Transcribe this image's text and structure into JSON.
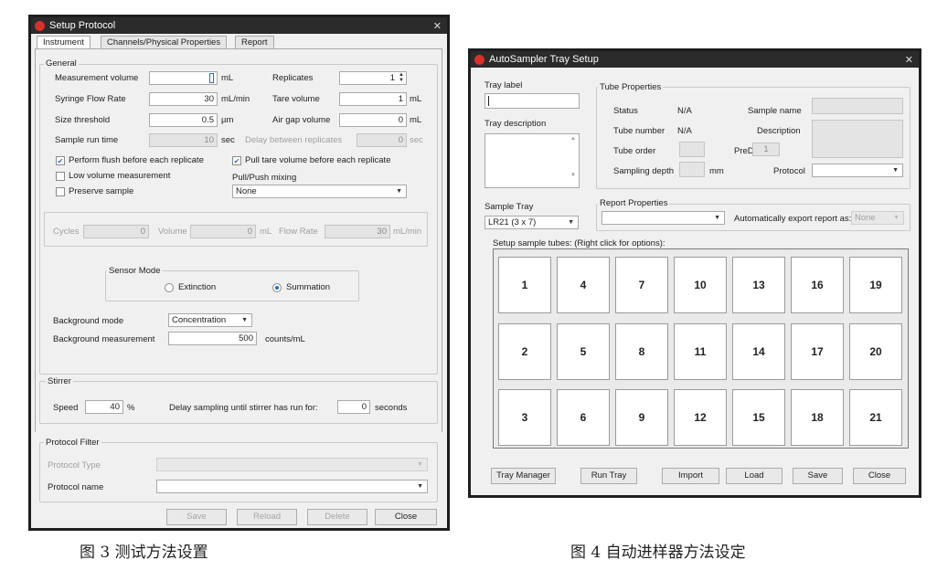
{
  "setup_protocol": {
    "title": "Setup Protocol",
    "tabs": [
      "Instrument",
      "Channels/Physical Properties",
      "Report"
    ],
    "general": {
      "label": "General",
      "measurement_volume": {
        "label": "Measurement volume",
        "value": "",
        "unit": "mL"
      },
      "replicates": {
        "label": "Replicates",
        "value": "1"
      },
      "syringe_flow_rate": {
        "label": "Syringe Flow Rate",
        "value": "30",
        "unit": "mL/min"
      },
      "tare_volume": {
        "label": "Tare volume",
        "value": "1",
        "unit": "mL"
      },
      "size_threshold": {
        "label": "Size threshold",
        "value": "0.5",
        "unit": "µm"
      },
      "air_gap_volume": {
        "label": "Air gap volume",
        "value": "0",
        "unit": "mL"
      },
      "sample_run_time": {
        "label": "Sample run time",
        "value": "10",
        "unit": "sec"
      },
      "delay_between_replicates": {
        "label": "Delay between replicates",
        "value": "0",
        "unit": "sec"
      },
      "perform_flush": {
        "label": "Perform flush before each replicate",
        "checked": true
      },
      "pull_tare": {
        "label": "Pull tare volume before each replicate",
        "checked": true
      },
      "low_volume": {
        "label": "Low volume measurement",
        "checked": false
      },
      "pull_push_mixing": {
        "label": "Pull/Push mixing",
        "value": "None"
      },
      "preserve_sample": {
        "label": "Preserve sample",
        "checked": false
      }
    },
    "cycles_row": {
      "cycles_label": "Cycles",
      "cycles_value": "0",
      "volume_label": "Volume",
      "volume_value": "0",
      "volume_unit": "mL",
      "flow_rate_label": "Flow Rate",
      "flow_rate_value": "30",
      "flow_rate_unit": "mL/min"
    },
    "sensor_mode": {
      "label": "Sensor Mode",
      "extinction": "Extinction",
      "summation": "Summation",
      "selected": "Summation"
    },
    "background_mode": {
      "label": "Background mode",
      "value": "Concentration"
    },
    "background_measurement": {
      "label": "Background measurement",
      "value": "500",
      "unit": "counts/mL"
    },
    "stirrer": {
      "label": "Stirrer",
      "speed_label": "Speed",
      "speed_value": "40",
      "speed_unit": "%",
      "delay_label": "Delay sampling until stirrer has run for:",
      "delay_value": "0",
      "delay_unit": "seconds"
    },
    "protocol_filter": {
      "label": "Protocol Filter",
      "type_label": "Protocol Type",
      "type_value": "",
      "name_label": "Protocol name",
      "name_value": ""
    },
    "buttons": {
      "save": "Save",
      "reload": "Reload",
      "delete": "Delete",
      "close": "Close"
    }
  },
  "autosampler": {
    "title": "AutoSampler Tray Setup",
    "tray_label": {
      "label": "Tray label",
      "value": ""
    },
    "tray_description": {
      "label": "Tray description",
      "value": ""
    },
    "tube_properties": {
      "label": "Tube Properties",
      "status_label": "Status",
      "status_value": "N/A",
      "sample_name_label": "Sample name",
      "tube_number_label": "Tube number",
      "tube_number_value": "N/A",
      "description_label": "Description",
      "tube_order_label": "Tube order",
      "predf_label": "PreDF",
      "predf_value": "1",
      "sampling_depth_label": "Sampling depth",
      "sampling_depth_unit": "mm",
      "protocol_label": "Protocol"
    },
    "sample_tray": {
      "label": "Sample Tray",
      "value": "LR21 (3 x 7)"
    },
    "report_properties": {
      "label": "Report Properties",
      "auto_export_label": "Automatically export report as:",
      "auto_export_value": "None"
    },
    "setup_tubes_label": "Setup sample tubes: (Right click for options):",
    "tubes": [
      [
        "1",
        "4",
        "7",
        "10",
        "13",
        "16",
        "19"
      ],
      [
        "2",
        "5",
        "8",
        "11",
        "14",
        "17",
        "20"
      ],
      [
        "3",
        "6",
        "9",
        "12",
        "15",
        "18",
        "21"
      ]
    ],
    "buttons": {
      "tray_manager": "Tray Manager",
      "run_tray": "Run Tray",
      "import": "Import",
      "load": "Load",
      "save": "Save",
      "close": "Close"
    }
  },
  "captions": {
    "left": "图 3 测试方法设置",
    "right": "图 4 自动进样器方法设定"
  }
}
